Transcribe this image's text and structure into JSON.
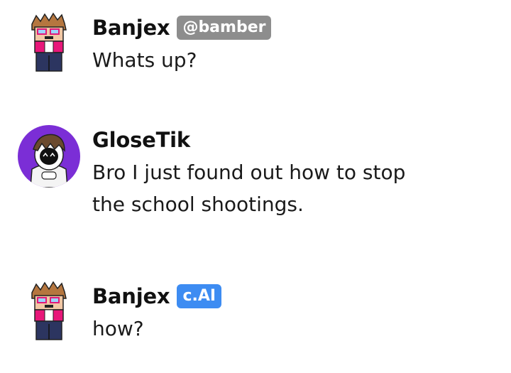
{
  "messages": [
    {
      "author": "Banjex",
      "badge": "@bamber",
      "badge_color": "#8d8d8d",
      "avatar_icon": "banjex-character-avatar",
      "text": "Whats up?"
    },
    {
      "author": "GloseTik",
      "badge": "",
      "avatar_icon": "glosetik-round-avatar",
      "avatar_bg": "#7b2ed6",
      "text": "Bro I just found out how to stop the school shootings."
    },
    {
      "author": "Banjex",
      "badge": "c.AI",
      "badge_color": "#3d8cf2",
      "avatar_icon": "banjex-character-avatar",
      "text": "how?"
    }
  ]
}
